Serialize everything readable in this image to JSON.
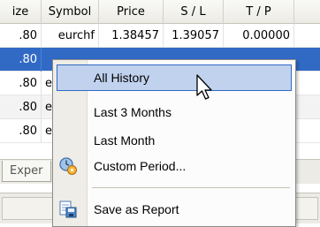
{
  "columns": [
    "ize",
    "Symbol",
    "Price",
    "S / L",
    "T / P"
  ],
  "rows": [
    {
      "size": ".80",
      "symbol": "eurchf",
      "price": "1.38457",
      "sl": "1.39057",
      "tp": "0.00000",
      "selected": false
    },
    {
      "size": ".80",
      "symbol": "",
      "price": "",
      "sl": "",
      "tp": "",
      "selected": true
    },
    {
      "size": ".80",
      "symbol": "e",
      "price": "",
      "sl": "",
      "tp": "",
      "selected": false
    },
    {
      "size": ".80",
      "symbol": "e",
      "price": "",
      "sl": "",
      "tp": "",
      "selected": false
    },
    {
      "size": ".80",
      "symbol": "e",
      "price": "",
      "sl": "",
      "tp": "",
      "selected": false
    }
  ],
  "bottom_tab": "Exper",
  "context_menu": {
    "items": [
      {
        "label": "All History",
        "icon": "",
        "highlighted": true
      },
      {
        "label": "Last 3 Months",
        "icon": "",
        "highlighted": false
      },
      {
        "label": "Last Month",
        "icon": "",
        "highlighted": false
      },
      {
        "label": "Custom Period...",
        "icon": "custom-period-icon",
        "highlighted": false
      },
      {
        "label": "Save as Report",
        "icon": "save-report-icon",
        "highlighted": false
      }
    ]
  },
  "colors": {
    "selection": "#316ac5",
    "menu_highlight": "#c1d2ee",
    "header_bg": "#ecebe5"
  }
}
